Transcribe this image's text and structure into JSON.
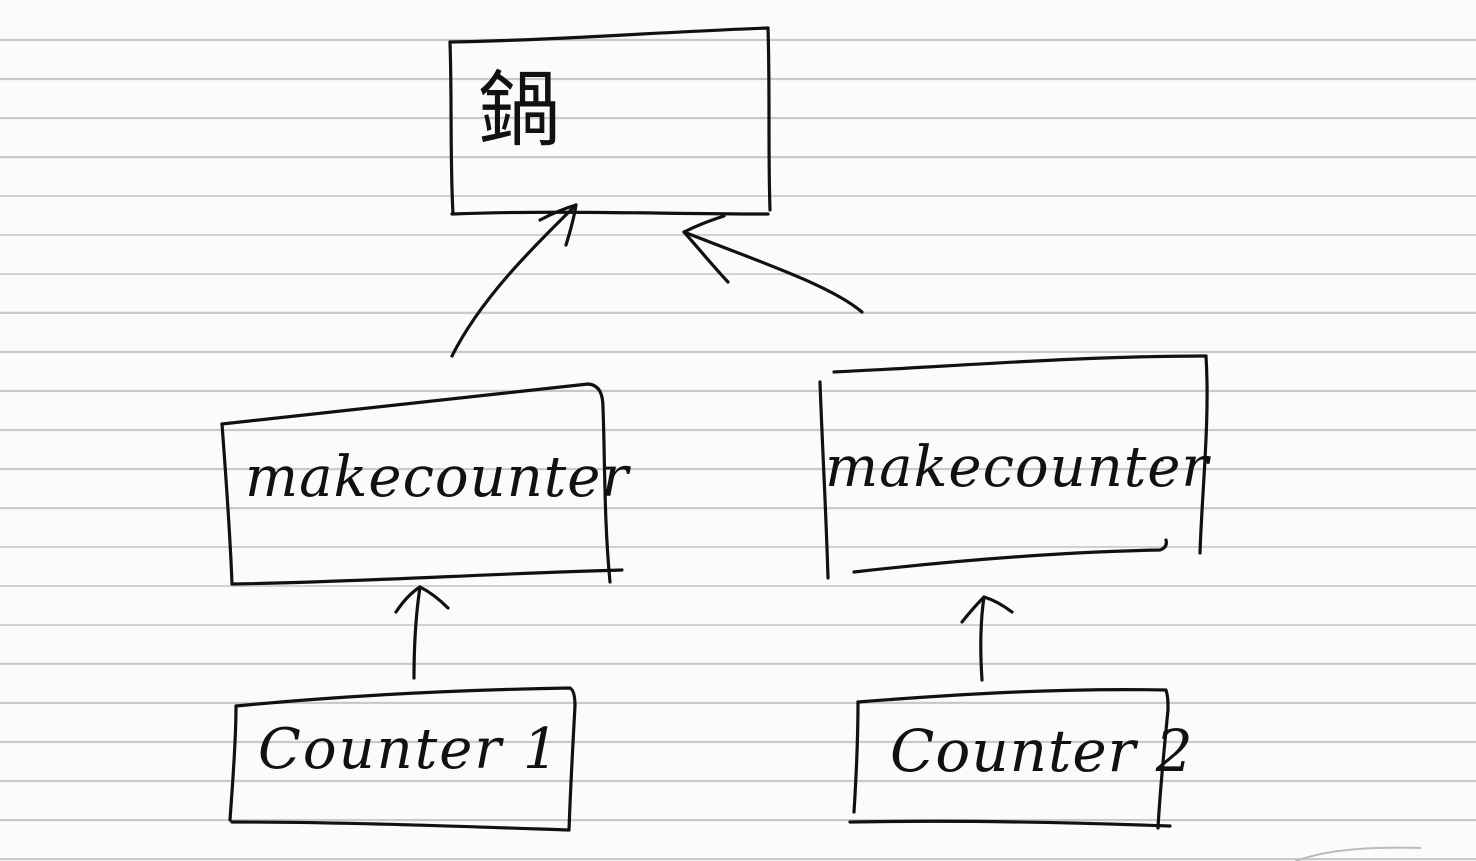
{
  "diagram": {
    "root_box": {
      "label": "鍋"
    },
    "makecounter_box_1": {
      "label": "makecounter"
    },
    "makecounter_box_2": {
      "label": "makecounter"
    },
    "counter_box_1": {
      "label": "Counter 1"
    },
    "counter_box_2": {
      "label": "Counter 2"
    }
  },
  "ink_color": "#111111",
  "paper": {
    "background": "#fbfbfb",
    "rule_color": "#c9c9c9"
  }
}
